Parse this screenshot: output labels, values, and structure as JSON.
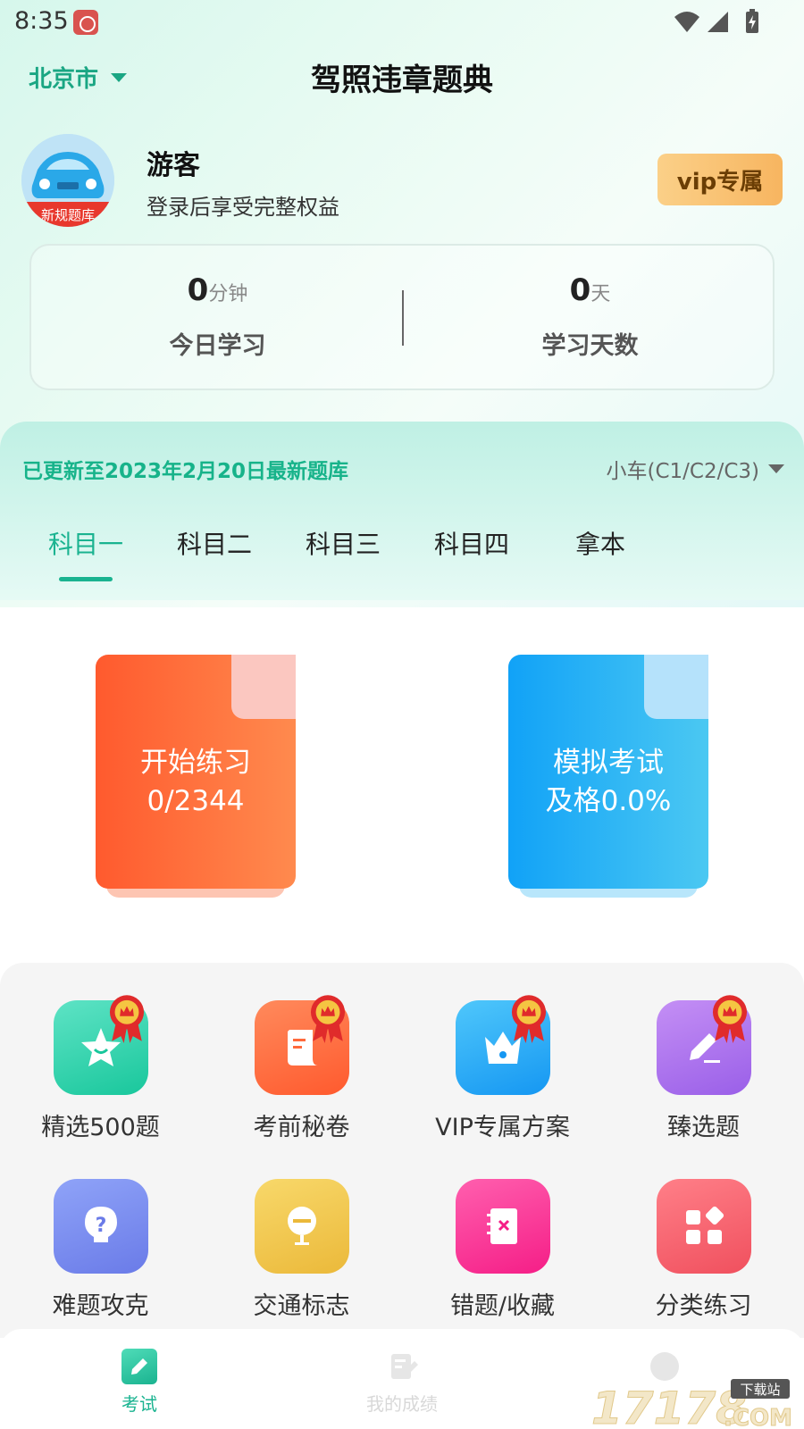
{
  "status_bar": {
    "time": "8:35"
  },
  "header": {
    "city": "北京市",
    "title": "驾照违章题典"
  },
  "profile": {
    "name": "游客",
    "subtitle": "登录后享受完整权益",
    "vip_label": "vip专属",
    "avatar_caption": "新规题库"
  },
  "stats": {
    "today_value": "0",
    "today_unit": "分钟",
    "today_label": "今日学习",
    "days_value": "0",
    "days_unit": "天",
    "days_label": "学习天数"
  },
  "update": {
    "text": "已更新至2023年2月20日最新题库",
    "car_type": "小车(C1/C2/C3)"
  },
  "tabs": [
    {
      "label": "科目一",
      "active": true
    },
    {
      "label": "科目二"
    },
    {
      "label": "科目三"
    },
    {
      "label": "科目四"
    },
    {
      "label": "拿本"
    }
  ],
  "cards": {
    "practice": {
      "line1": "开始练习",
      "line2": "0/2344"
    },
    "exam": {
      "line1": "模拟考试",
      "line2": "及格0.0%"
    }
  },
  "features": [
    {
      "label": "精选500题",
      "icon": "star-icon",
      "vip": true
    },
    {
      "label": "考前秘卷",
      "icon": "scroll-icon",
      "vip": true
    },
    {
      "label": "VIP专属方案",
      "icon": "crown-icon",
      "vip": true
    },
    {
      "label": "臻选题",
      "icon": "pen-icon",
      "vip": true
    },
    {
      "label": "难题攻克",
      "icon": "bulb-icon"
    },
    {
      "label": "交通标志",
      "icon": "sign-icon"
    },
    {
      "label": "错题/收藏",
      "icon": "notebook-icon"
    },
    {
      "label": "分类练习",
      "icon": "category-icon"
    }
  ],
  "bottom_nav": [
    {
      "label": "考试",
      "active": true
    },
    {
      "label": "我的成绩"
    }
  ],
  "colors": {
    "accent": "#1ab390",
    "vip": "#f7b560",
    "orange_card": "#ff5a2e",
    "blue_card": "#11a2f7"
  },
  "watermark": {
    "text": "17178.COM",
    "badge": "下载站"
  }
}
